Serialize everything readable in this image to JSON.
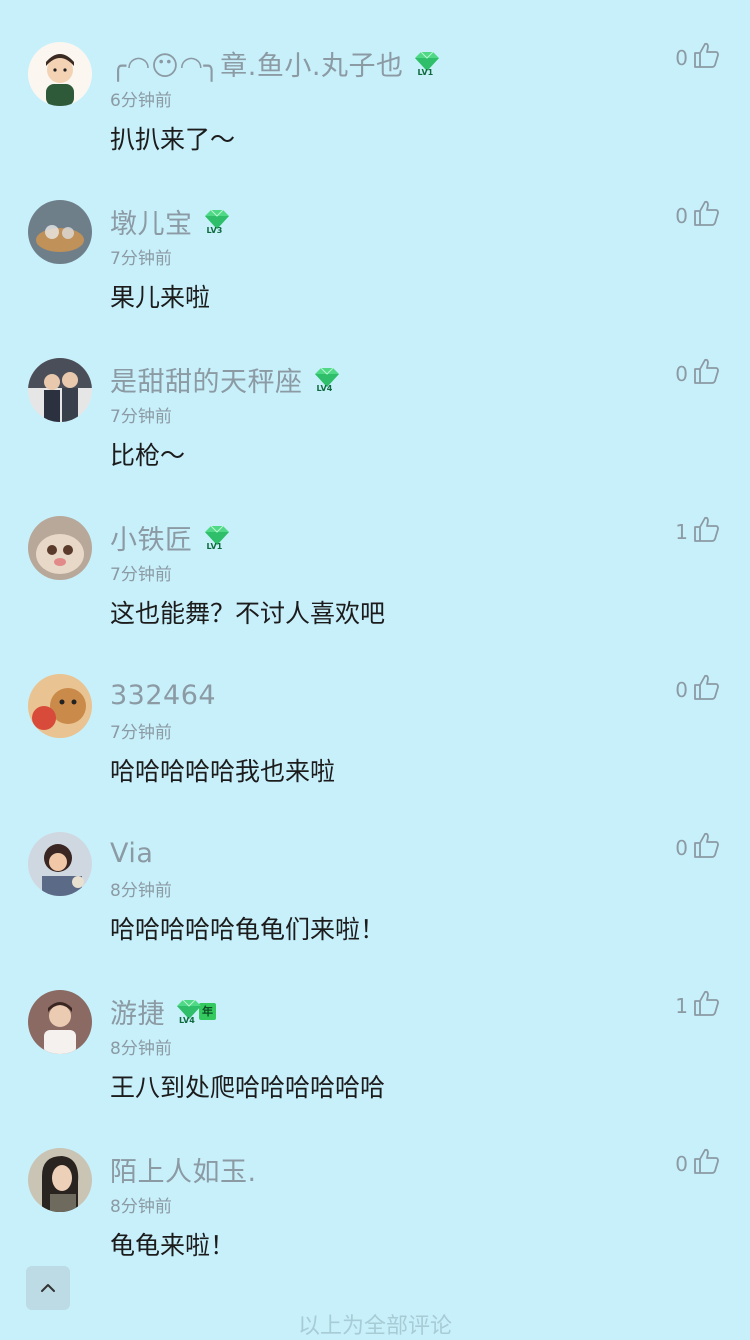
{
  "comments": [
    {
      "username": "╭◠😶◠╮章.鱼小.丸子也",
      "level": "LV1",
      "time": "6分钟前",
      "content": "扒扒来了～",
      "likes": "0",
      "avatar_color": "#f0e6d8"
    },
    {
      "username": "墩儿宝",
      "level": "LV3",
      "time": "7分钟前",
      "content": "果儿来啦",
      "likes": "0",
      "avatar_color": "#6f7f8a"
    },
    {
      "username": "是甜甜的天秤座",
      "level": "LV4",
      "time": "7分钟前",
      "content": "比枪～",
      "likes": "0",
      "avatar_color": "#4a4e58"
    },
    {
      "username": "小铁匠",
      "level": "LV1",
      "time": "7分钟前",
      "content": "这也能舞？不讨人喜欢吧",
      "likes": "1",
      "avatar_color": "#b8a89a"
    },
    {
      "username": "332464",
      "level": "",
      "time": "7分钟前",
      "content": "哈哈哈哈哈我也来啦",
      "likes": "0",
      "avatar_color": "#c98a4a"
    },
    {
      "username": "Via",
      "level": "",
      "time": "8分钟前",
      "content": "哈哈哈哈哈龟龟们来啦！",
      "likes": "0",
      "avatar_color": "#5b6a86"
    },
    {
      "username": "游捷",
      "level": "LV4",
      "year_tag": "年",
      "time": "8分钟前",
      "content": "王八到处爬哈哈哈哈哈哈",
      "likes": "1",
      "avatar_color": "#8a6a62"
    },
    {
      "username": "陌上人如玉.",
      "level": "",
      "time": "8分钟前",
      "content": "龟龟来啦！",
      "likes": "0",
      "avatar_color": "#6e6a5e"
    }
  ],
  "footer": {
    "text": "以上为全部评论"
  },
  "colors": {
    "background": "#c8f0fb",
    "meta_text": "#8b9aa3",
    "badge_green": "#33c95f"
  },
  "icons": {
    "like": "thumbs-up-icon",
    "back_to_top": "chevron-up-icon",
    "level": "gem-level-icon"
  }
}
